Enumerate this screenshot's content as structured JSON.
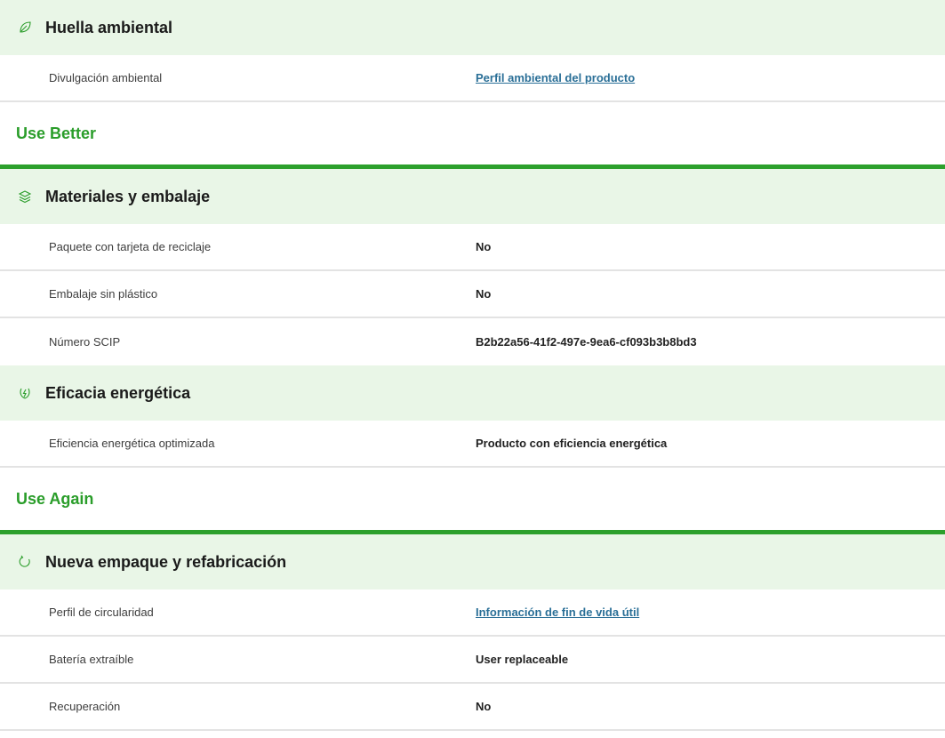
{
  "colors": {
    "band_bg": "#e9f6e7",
    "group_green": "#2a9d2a",
    "rule_green": "#2ca02c",
    "link": "#2a6f97"
  },
  "sections": {
    "footprint": {
      "title": "Huella ambiental",
      "icon": "leaf-icon",
      "rows": [
        {
          "label": "Divulgación ambiental",
          "value": "Perfil ambiental del producto",
          "is_link": true
        }
      ]
    },
    "use_better": {
      "heading": "Use Better",
      "materials": {
        "title": "Materiales y embalaje",
        "icon": "layers-icon",
        "rows": [
          {
            "label": "Paquete con tarjeta de reciclaje",
            "value": "No"
          },
          {
            "label": "Embalaje sin plástico",
            "value": "No"
          },
          {
            "label": "Número SCIP",
            "value": "B2b22a56-41f2-497e-9ea6-cf093b3b8bd3"
          }
        ]
      },
      "energy": {
        "title": "Eficacia energética",
        "icon": "energy-leaf-icon",
        "rows": [
          {
            "label": "Eficiencia energética optimizada",
            "value": "Producto con eficiencia energética"
          }
        ]
      }
    },
    "use_again": {
      "heading": "Use Again",
      "repack": {
        "title": "Nueva empaque y refabricación",
        "icon": "refresh-icon",
        "rows": [
          {
            "label": "Perfil de circularidad",
            "value": "Información de fin de vida útil",
            "is_link": true
          },
          {
            "label": "Batería extraíble",
            "value": "User replaceable"
          },
          {
            "label": "Recuperación",
            "value": "No"
          }
        ]
      }
    }
  }
}
